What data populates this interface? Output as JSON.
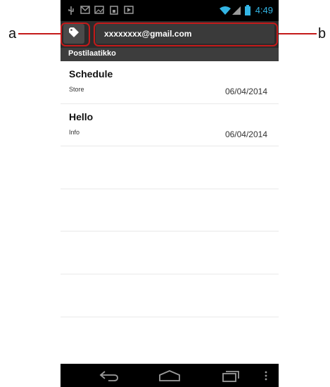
{
  "annotations": {
    "left_letter": "a",
    "right_letter": "b"
  },
  "status_bar": {
    "time": "4:49",
    "icons": [
      "usb-icon",
      "gmail-notification-icon",
      "image-icon",
      "sd-card-icon",
      "media-icon",
      "wifi-icon",
      "signal-icon",
      "battery-icon"
    ],
    "time_color": "#33b5e5"
  },
  "action_bar": {
    "label_icon": "label-tag-icon",
    "account": "xxxxxxxx@gmail.com"
  },
  "folder": {
    "title": "Postilaatikko"
  },
  "messages": [
    {
      "subject": "Schedule",
      "sender": "Store",
      "date": "06/04/2014"
    },
    {
      "subject": "Hello",
      "sender": "Info",
      "date": "06/04/2014"
    }
  ],
  "nav_bar": {
    "icons": [
      "back-icon",
      "home-icon",
      "recent-apps-icon",
      "overflow-menu-icon"
    ]
  },
  "colors": {
    "callout": "#c41a1a",
    "action_bar": "#2b2b2b",
    "folder_bar": "#3d3d3d"
  }
}
